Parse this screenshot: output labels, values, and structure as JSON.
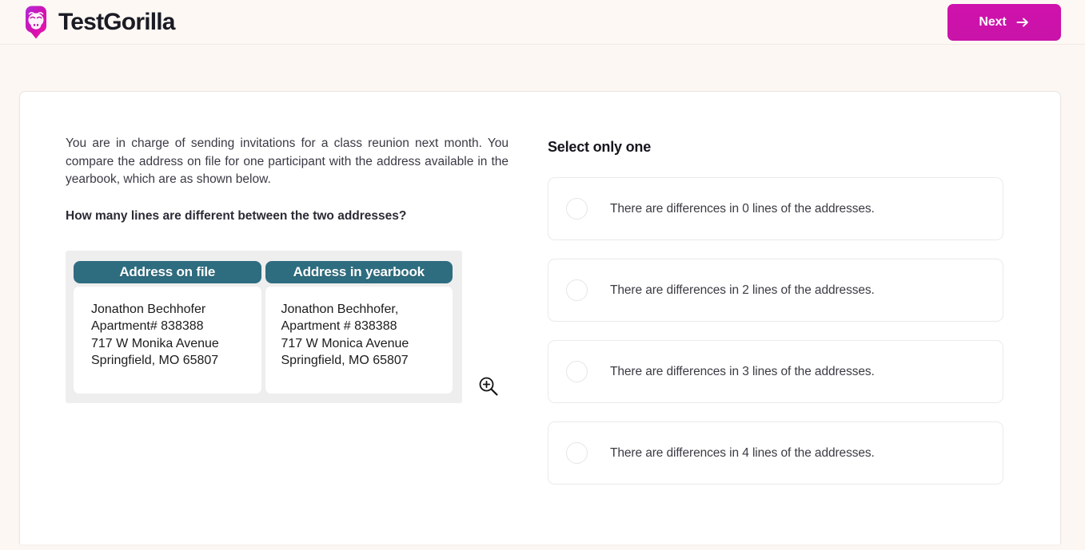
{
  "header": {
    "brand_name": "TestGorilla",
    "logo_icon": "gorilla-logo-icon",
    "next_label": "Next",
    "next_icon": "arrow-right-icon",
    "accent_color": "#cf12ac"
  },
  "question": {
    "scenario": "You are in charge of sending invitations for a class reunion next month. You compare the address on file for one participant with the address available in the yearbook, which are as shown below.",
    "prompt": "How many lines are different between the two addresses?",
    "zoom_icon": "magnifier-plus-icon"
  },
  "address_compare": {
    "header_color": "#2e6d80",
    "columns": [
      {
        "header": "Address on file",
        "lines": [
          "Jonathon Bechhofer",
          "Apartment# 838388",
          "717 W Monika Avenue",
          "Springfield, MO 65807"
        ]
      },
      {
        "header": "Address in yearbook",
        "lines": [
          "Jonathon Bechhofer,",
          "Apartment # 838388",
          "717 W Monica Avenue",
          "Springfield, MO 65807"
        ]
      }
    ]
  },
  "answers": {
    "title": "Select only one",
    "options": [
      {
        "label": "There are differences in 0 lines of the addresses.",
        "selected": false
      },
      {
        "label": "There are differences in 2 lines of the addresses.",
        "selected": false
      },
      {
        "label": "There are differences in 3 lines of the addresses.",
        "selected": false
      },
      {
        "label": "There are differences in 4 lines of the addresses.",
        "selected": false
      }
    ]
  }
}
